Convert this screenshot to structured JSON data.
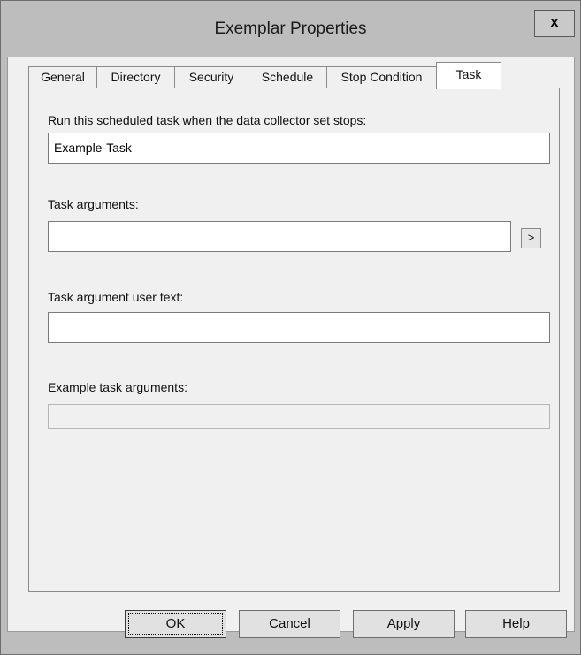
{
  "window": {
    "title": "Exemplar Properties",
    "close_label": "x"
  },
  "tabs": [
    {
      "label": "General",
      "active": false
    },
    {
      "label": "Directory",
      "active": false
    },
    {
      "label": "Security",
      "active": false
    },
    {
      "label": "Schedule",
      "active": false
    },
    {
      "label": "Stop Condition",
      "active": false
    },
    {
      "label": "Task",
      "active": true
    }
  ],
  "task": {
    "run_label": "Run this scheduled task when the data collector set stops:",
    "run_value": "Example-Task",
    "args_label": "Task arguments:",
    "args_value": "",
    "args_insert_button": ">",
    "user_text_label": "Task argument user text:",
    "user_text_value": "",
    "example_label": "Example task arguments:",
    "example_value": ""
  },
  "buttons": {
    "ok": "OK",
    "cancel": "Cancel",
    "apply": "Apply",
    "help": "Help"
  }
}
